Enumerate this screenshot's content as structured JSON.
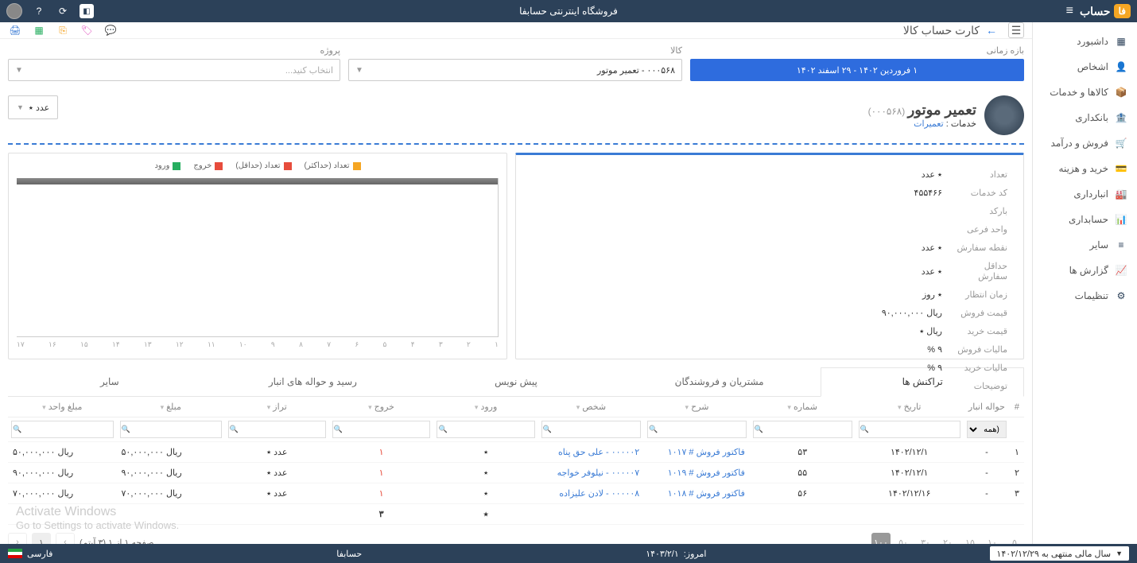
{
  "topbar": {
    "store_name": "فروشگاه اینترنتی حسابفا",
    "brand": "حساب",
    "brand_badge": "فا"
  },
  "sidebar": {
    "items": [
      {
        "label": "داشبورد",
        "icon": "dash"
      },
      {
        "label": "اشخاص",
        "icon": "person"
      },
      {
        "label": "کالاها و خدمات",
        "icon": "box"
      },
      {
        "label": "بانکداری",
        "icon": "bank"
      },
      {
        "label": "فروش و درآمد",
        "icon": "sale"
      },
      {
        "label": "خرید و هزینه",
        "icon": "buy"
      },
      {
        "label": "انبارداری",
        "icon": "wh"
      },
      {
        "label": "حسابداری",
        "icon": "acc"
      },
      {
        "label": "سایر",
        "icon": "oth"
      },
      {
        "label": "گزارش ها",
        "icon": "rep"
      },
      {
        "label": "تنظیمات",
        "icon": "set"
      }
    ]
  },
  "toolbar": {
    "title": "کارت حساب کالا"
  },
  "filters": {
    "range_label": "بازه زمانی",
    "range_value": "۱ فروردین ۱۴۰۲ - ۲۹ اسفند ۱۴۰۲",
    "product_label": "کالا",
    "product_value": "۰۰۰۵۶۸ - تعمیر موتور",
    "project_label": "پروژه",
    "project_placeholder": "انتخاب کنید..."
  },
  "product": {
    "name": "تعمیر موتور",
    "code": "(۰۰۰۵۶۸)",
    "cat_label": "خدمات : ",
    "cat_link": "تعمیرات",
    "unit": "عدد ٭"
  },
  "info": [
    {
      "label": "تعداد",
      "value": "٭ عدد"
    },
    {
      "label": "کد خدمات",
      "value": "۴۵۵۴۶۶"
    },
    {
      "label": "بارکد",
      "value": ""
    },
    {
      "label": "واحد فرعی",
      "value": ""
    },
    {
      "label": "نقطه سفارش",
      "value": "٭ عدد"
    },
    {
      "label": "حداقل سفارش",
      "value": "٭ عدد"
    },
    {
      "label": "زمان انتظار",
      "value": "٭ روز"
    },
    {
      "label": "قیمت فروش",
      "value": "ریال ۹۰,۰۰۰,۰۰۰"
    },
    {
      "label": "قیمت خرید",
      "value": "ریال ٭"
    },
    {
      "label": "مالیات فروش",
      "value": "۹ %"
    },
    {
      "label": "مالیات خرید",
      "value": "۹ %"
    },
    {
      "label": "توضیحات",
      "value": ""
    }
  ],
  "chart_data": {
    "type": "bar",
    "legend": [
      {
        "name": "تعداد (حداکثر)",
        "color": "#f5a623"
      },
      {
        "name": "تعداد (حداقل)",
        "color": "#e74c3c"
      },
      {
        "name": "خروج",
        "color": "#e74c3c"
      },
      {
        "name": "ورود",
        "color": "#27ae60"
      }
    ],
    "xticks": [
      "۱",
      "۲",
      "۳",
      "۴",
      "۵",
      "۶",
      "۷",
      "۸",
      "۹",
      "۱۰",
      "۱۱",
      "۱۲",
      "۱۳",
      "۱۴",
      "۱۵",
      "۱۶",
      "۱۷"
    ]
  },
  "tabs": [
    {
      "label": "تراکنش ها",
      "key": "trans",
      "active": true
    },
    {
      "label": "مشتریان و فروشندگان",
      "key": "cust"
    },
    {
      "label": "پیش نویس",
      "key": "draft"
    },
    {
      "label": "رسید و حواله های انبار",
      "key": "wh"
    },
    {
      "label": "سایر",
      "key": "other"
    }
  ],
  "table": {
    "headers": [
      "#",
      "حواله انبار",
      "تاریخ",
      "شماره",
      "شرح",
      "شخص",
      "ورود",
      "خروج",
      "تراز",
      "مبلغ",
      "مبلغ واحد"
    ],
    "filter_all": "(همه)",
    "rows": [
      {
        "idx": "۱",
        "wh": "-",
        "date": "۱۴۰۲/۱۲/۱",
        "num": "۵۳",
        "desc": "فاکتور فروش # ۱۰۱۷",
        "person": "۰۰۰۰۰۲ - علی حق پناه",
        "in": "٭",
        "out": "۱",
        "bal": "عدد ٭",
        "amount": "ریال ۵۰,۰۰۰,۰۰۰",
        "unit_price": "ریال ۵۰,۰۰۰,۰۰۰"
      },
      {
        "idx": "۲",
        "wh": "-",
        "date": "۱۴۰۲/۱۲/۱",
        "num": "۵۵",
        "desc": "فاکتور فروش # ۱۰۱۹",
        "person": "۰۰۰۰۰۷ - نیلوفر خواجه",
        "in": "٭",
        "out": "۱",
        "bal": "عدد ٭",
        "amount": "ریال ۹۰,۰۰۰,۰۰۰",
        "unit_price": "ریال ۹۰,۰۰۰,۰۰۰"
      },
      {
        "idx": "۳",
        "wh": "-",
        "date": "۱۴۰۲/۱۲/۱۶",
        "num": "۵۶",
        "desc": "فاکتور فروش # ۱۰۱۸",
        "person": "۰۰۰۰۰۸ - لادن علیزاده",
        "in": "٭",
        "out": "۱",
        "bal": "عدد ٭",
        "amount": "ریال ۷۰,۰۰۰,۰۰۰",
        "unit_price": "ریال ۷۰,۰۰۰,۰۰۰"
      }
    ],
    "totals": {
      "in": "٭",
      "out": "۳"
    }
  },
  "pager": {
    "sizes": [
      "۵",
      "۱۰",
      "۱۵",
      "۲۰",
      "۳۰",
      "۵۰",
      "۱۰۰"
    ],
    "active_size": "۱۰۰",
    "info": "صفحه ۱ از ۱ (۳ آیتم)",
    "page": "۱"
  },
  "watermark": {
    "l1": "Activate Windows",
    "l2": "Go to Settings to activate Windows."
  },
  "footer": {
    "fy": "سال مالی منتهی به ۱۴۰۲/۱۲/۲۹",
    "today_label": "امروز:",
    "today": "۱۴۰۳/۲/۱",
    "brand": "حسابفا",
    "lang": "فارسی"
  }
}
